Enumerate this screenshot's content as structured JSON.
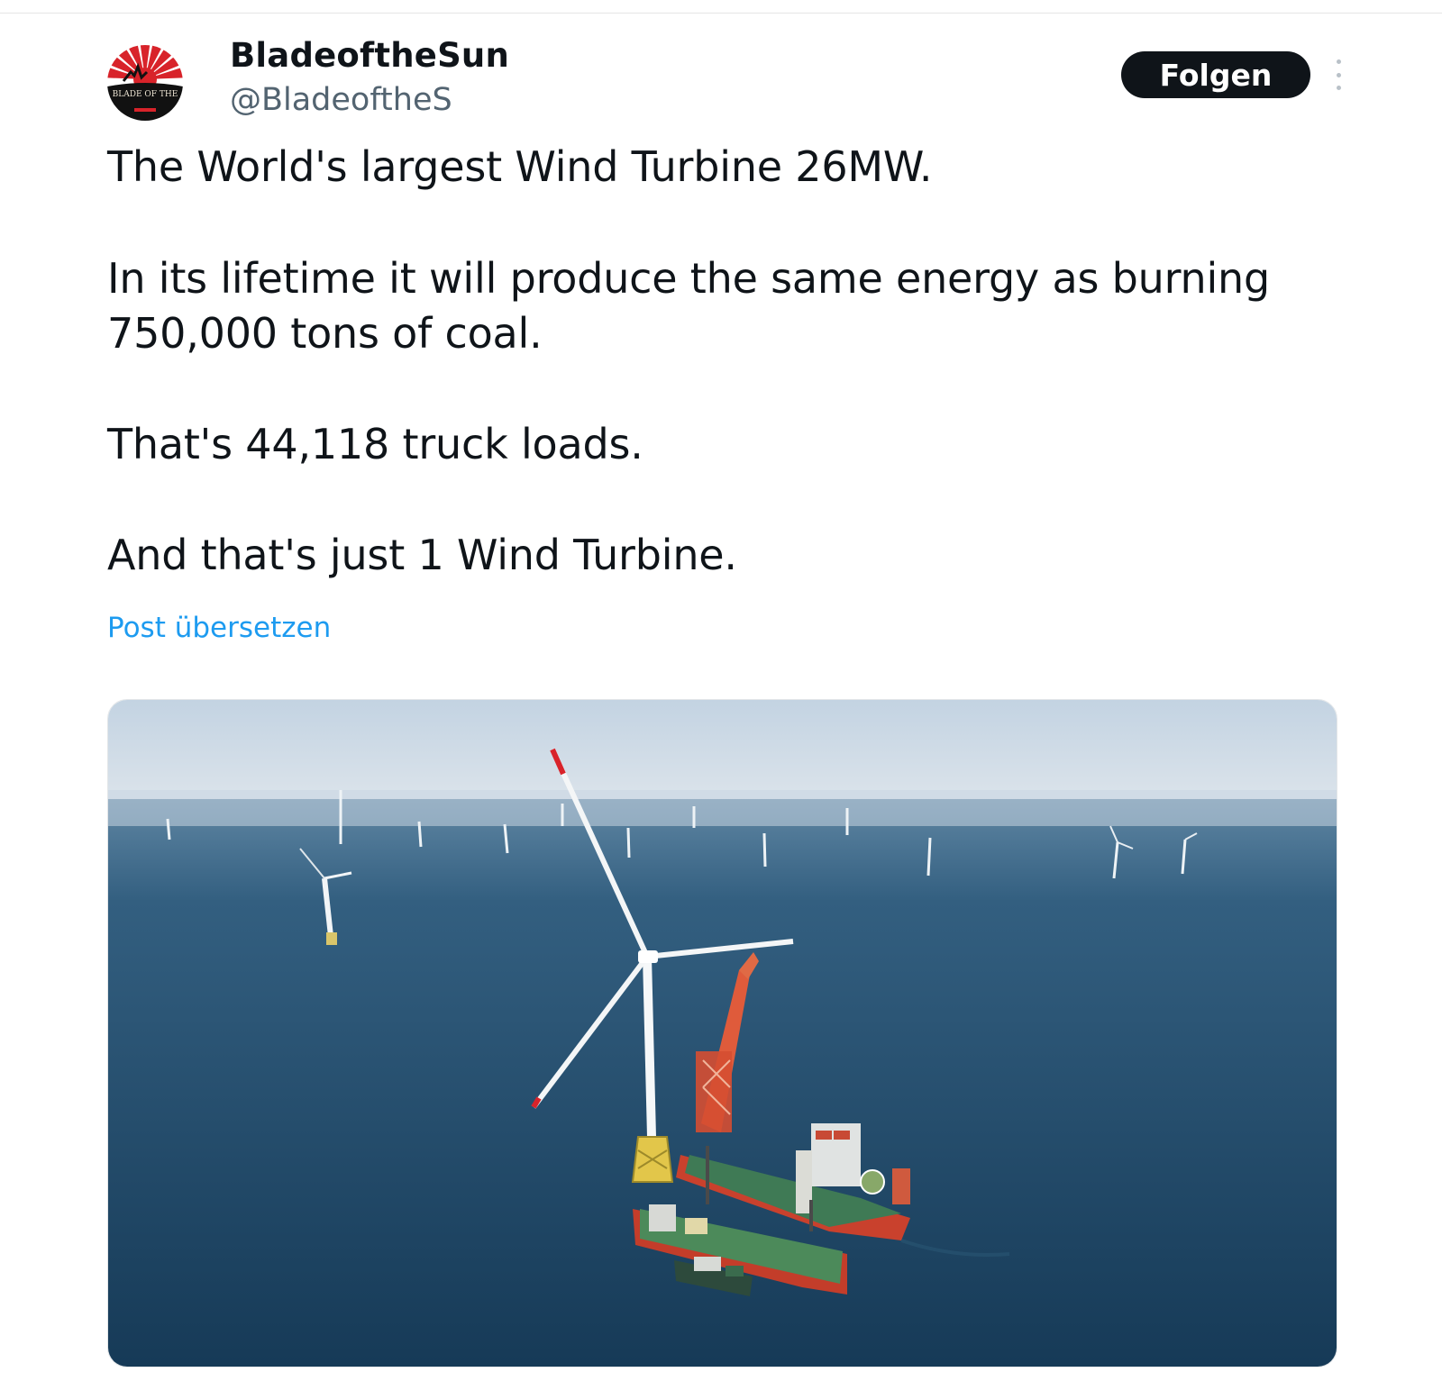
{
  "author": {
    "display_name": "BladeoftheSun",
    "handle": "@BladeoftheS",
    "avatar_icon": "rising-sun-avatar",
    "avatar_text": "BLADE OF THE"
  },
  "actions": {
    "follow_label": "Folgen",
    "more_icon": "more-vertical-icon"
  },
  "tweet": {
    "lines": [
      "The World's largest Wind Turbine 26MW.",
      "In its lifetime it will produce the same energy as burning",
      "750,000 tons of coal.",
      "That's 44,118 truck loads.",
      "And that's just 1 Wind Turbine."
    ],
    "translate_label": "Post übersetzen"
  },
  "media": {
    "kind": "photo",
    "icon": "offshore-wind-turbine-photo"
  },
  "colors": {
    "text_primary": "#0f1419",
    "text_secondary": "#536471",
    "link": "#1d9bf0",
    "button_bg": "#0f1419",
    "sea": "#1f4d6b",
    "sky": "#cfdbe6"
  }
}
